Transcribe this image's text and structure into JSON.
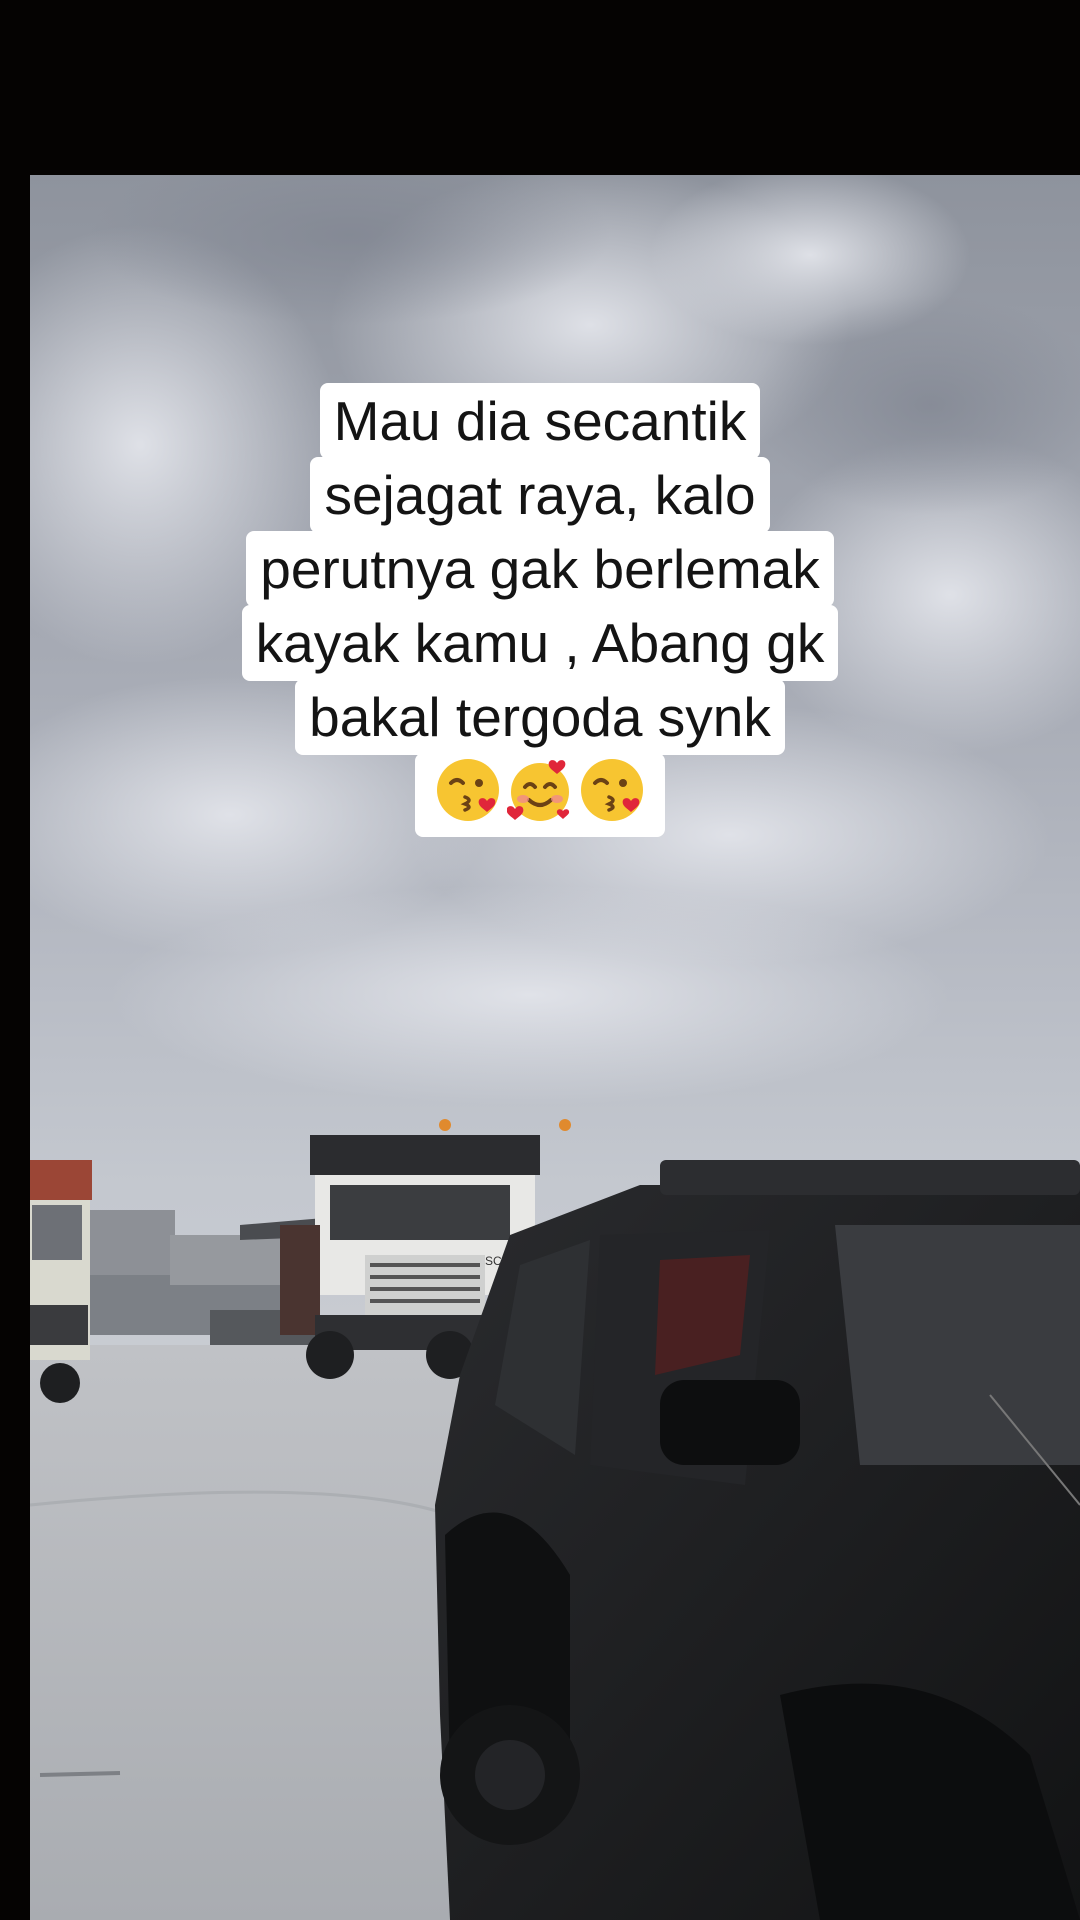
{
  "caption": {
    "lines": [
      "Mau dia secantik",
      "sejagat raya, kalo",
      "perutnya gak berlemak",
      "kayak kamu , Abang gk",
      "bakal tergoda synk"
    ],
    "emojis": [
      "kissing-face-with-heart-emoji",
      "smiling-face-with-hearts-emoji",
      "kissing-face-with-heart-emoji"
    ]
  },
  "photo": {
    "scene": "photo",
    "colors": {
      "sky": "#a4a8b2",
      "ground": "#b3b6bb",
      "car": "#1b1c1e"
    },
    "truck_brand": "SCANIA"
  }
}
